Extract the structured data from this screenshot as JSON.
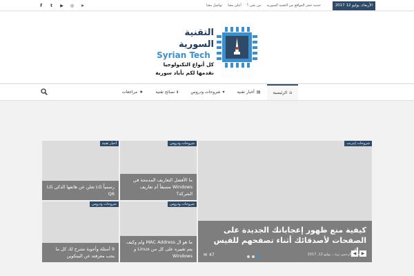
{
  "topbar": {
    "date": "الأربعاء, يوليو 12 2017",
    "links": [
      "خدمة حجز المواقع من التقنية السورية",
      "من نحن ؟",
      "أعلن معنا",
      "تواصل معنا"
    ],
    "social_icons": [
      "facebook-icon",
      "twitter-icon",
      "youtube-icon",
      "instagram-icon",
      "telegram-icon"
    ],
    "social_glyphs": [
      "f",
      "t",
      "▶",
      "◎",
      "➤"
    ]
  },
  "logo": {
    "title": "التقنية السورية",
    "latin": "Syrian Tech",
    "tagline1": "كل أنواع التكنولوجيا",
    "tagline2": "نقدمها لكم بأياد سورية"
  },
  "nav": {
    "items": [
      {
        "label": "الرئيسية",
        "icon": "home-icon",
        "glyph": "⌂",
        "active": true
      },
      {
        "label": "أخبار تقنية",
        "icon": "newspaper-icon",
        "glyph": "▤",
        "active": false
      },
      {
        "label": "شروحات ودروس",
        "icon": "book-icon",
        "glyph": "▾",
        "active": false
      },
      {
        "label": "نصائح تقنية",
        "icon": "info-icon",
        "glyph": "ℹ",
        "active": false
      },
      {
        "label": "مراجعات",
        "icon": "star-icon",
        "glyph": "★",
        "active": false
      }
    ]
  },
  "slider": {
    "featured": {
      "category": "شروحات إنترنت",
      "title": "كيفية منع ظهور إعجاباتك الجديدة على الصفحات لأصدقائك أثناء تصفحهم للفيس بوك",
      "meta": "محمد عبد الرحمن برة... يوليو 12, 2017",
      "comments": "47"
    },
    "cells": [
      {
        "category": "شروحات ودروس",
        "caption": "ما الأفضل  التعاريف المدمجة في Windows مسبقاً أم تعاريف الشركة؟"
      },
      {
        "category": "أخبار تقنية",
        "caption": "رسمياً  LG تعلن عن هاتفها الذكي LG Q6"
      },
      {
        "category": "شروحات ودروس",
        "caption": "ما هو ال MAC Address ولم وكيف يتم تغييره على كل من Linux و Windows"
      },
      {
        "category": "شروحات ودروس",
        "caption": "9 أسئلة وأجوبة تشرح لك كل ما يجب معرفته عن البيتكوين"
      }
    ],
    "prev_arrow": "◀",
    "next_arrow": "▶"
  },
  "colors": {
    "accent": "#2e4a66",
    "brand_blue": "#3a8fd0",
    "caption_bg": "#7e7e7e"
  }
}
